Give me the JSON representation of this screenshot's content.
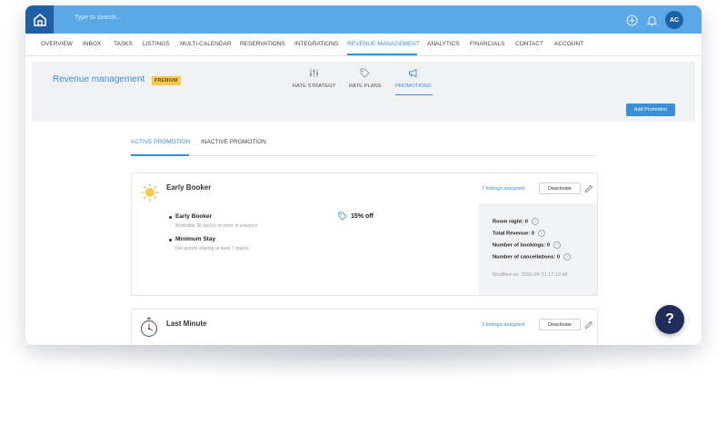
{
  "topbar": {
    "search_placeholder": "Type to search...",
    "avatar_initials": "AC"
  },
  "nav": {
    "items": [
      "OVERVIEW",
      "INBOX",
      "TASKS",
      "LISTINGS",
      "MULTI-CALENDAR",
      "RESERVATIONS",
      "INTEGRATIONS",
      "REVENUE MANAGEMENT",
      "ANALYTICS",
      "FINANCIALS",
      "CONTACT",
      "ACCOUNT"
    ],
    "active": "REVENUE MANAGEMENT"
  },
  "page": {
    "title": "Revenue management",
    "badge": "PREMIUM"
  },
  "subtabs": [
    "RATE STRATEGY",
    "RATE PLANS",
    "PROMOTIONS"
  ],
  "add_button": "Add Promotion",
  "promo_tabs": [
    "ACTIVE PROMOTION",
    "INACTIVE PROMOTION"
  ],
  "promotions": [
    {
      "name": "Early Booker",
      "icon": "sun-icon",
      "listings": "7 listings assigned",
      "deactivate": "Deactivate",
      "conditions": [
        {
          "title": "Early Booker",
          "detail": "Bookable 30 day(s) or more in advance"
        },
        {
          "title": "Minimum Stay",
          "detail": "For guests staying at least 7 day(s)"
        }
      ],
      "discount": "15% off",
      "stats": {
        "room_night": "Room night: 0",
        "total_revenue": "Total Revenue: 0",
        "bookings": "Number of bookings: 0",
        "cancellations": "Number of cancellations: 0",
        "modified": "Modified on: 2020-08-31 17:12:42"
      }
    },
    {
      "name": "Last Minute",
      "icon": "stopwatch-icon",
      "listings": "3 listings assigned",
      "deactivate": "Deactivate"
    }
  ],
  "help_label": "?",
  "colors": {
    "topbar": "#5aa9e6",
    "accent": "#3a8fd6",
    "logo_bg": "#1f5fa8",
    "badge": "#f6c94a",
    "help_bg": "#1f2d5a"
  }
}
